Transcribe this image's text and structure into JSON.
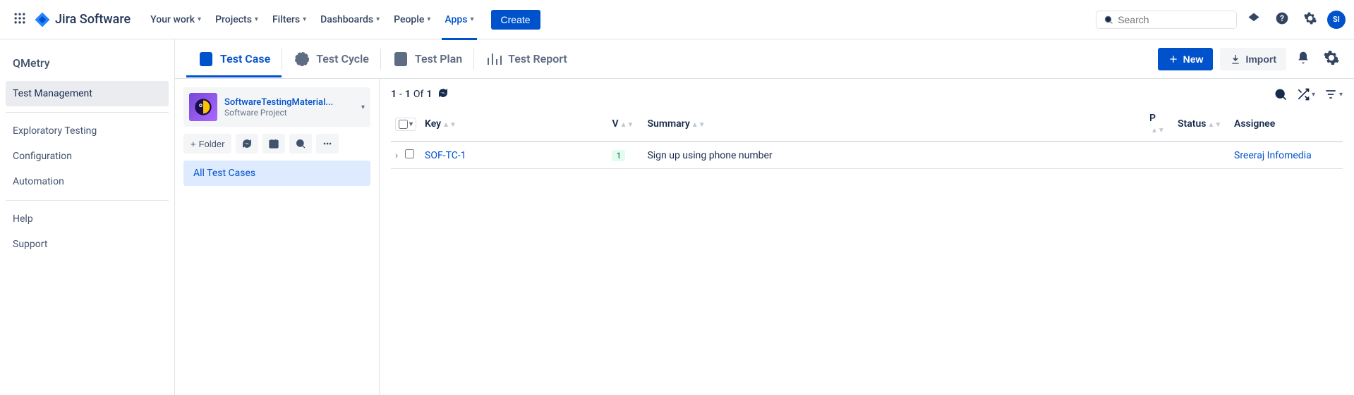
{
  "header": {
    "logo_text": "Jira Software",
    "nav": {
      "your_work": "Your work",
      "projects": "Projects",
      "filters": "Filters",
      "dashboards": "Dashboards",
      "people": "People",
      "apps": "Apps"
    },
    "create_label": "Create",
    "search_placeholder": "Search",
    "avatar_initials": "SI"
  },
  "sidebar": {
    "title": "QMetry",
    "items": {
      "test_management": "Test Management",
      "exploratory_testing": "Exploratory Testing",
      "configuration": "Configuration",
      "automation": "Automation",
      "help": "Help",
      "support": "Support"
    }
  },
  "tabs": {
    "test_case": "Test Case",
    "test_cycle": "Test Cycle",
    "test_plan": "Test Plan",
    "test_report": "Test Report",
    "new_label": "New",
    "import_label": "Import"
  },
  "folder_panel": {
    "project_name": "SoftwareTestingMaterial...",
    "project_type": "Software Project",
    "folder_label": "Folder",
    "all_test_cases": "All Test Cases"
  },
  "table": {
    "pagination_start": "1",
    "pagination_end": "1",
    "pagination_of": "Of",
    "pagination_total": "1",
    "columns": {
      "key": "Key",
      "v": "V",
      "summary": "Summary",
      "p": "P",
      "status": "Status",
      "assignee": "Assignee"
    },
    "rows": [
      {
        "key": "SOF-TC-1",
        "v": "1",
        "summary": "Sign up using phone number",
        "p": "",
        "status": "",
        "assignee": "Sreeraj Infomedia"
      }
    ]
  }
}
